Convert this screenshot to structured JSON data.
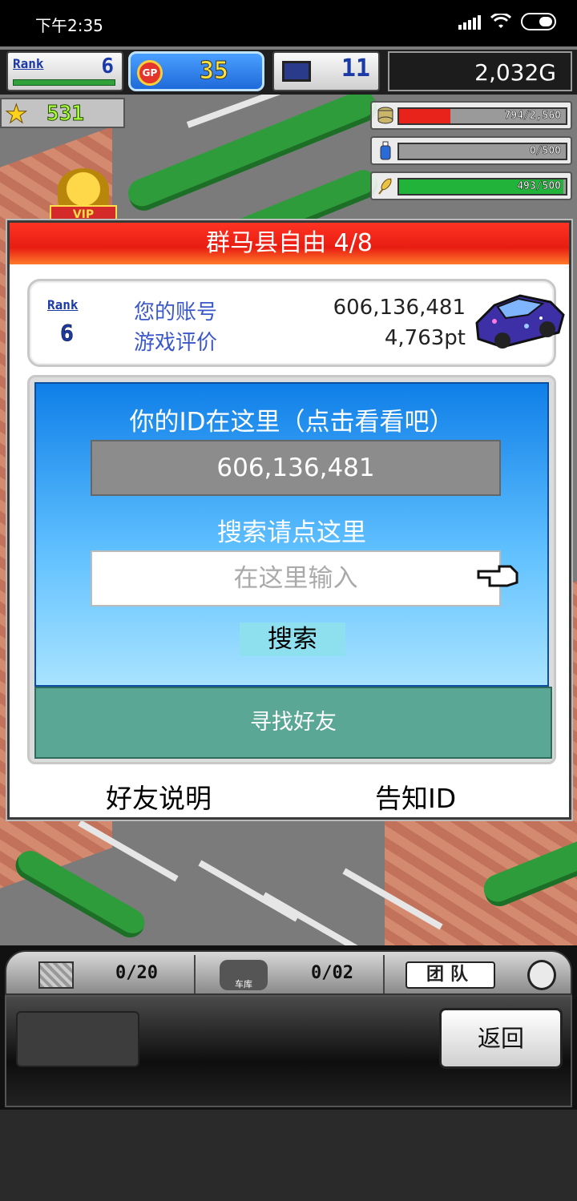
{
  "status_bar": {
    "time": "下午2:35"
  },
  "hud": {
    "rank_label": "Rank",
    "rank_value": "6",
    "gp_label": "GP",
    "gp_value": "35",
    "pc_value": "11",
    "gold": "2,032G",
    "stars": "531",
    "resources": [
      {
        "icon": "coin-stack-icon",
        "text": "794/2,560",
        "fill": 0.31,
        "color": "#e8231b"
      },
      {
        "icon": "bottle-icon",
        "text": "0/500",
        "fill": 0.0,
        "color": "#2a6bd8"
      },
      {
        "icon": "wheat-icon",
        "text": "493/500",
        "fill": 0.986,
        "color": "#22b33a"
      }
    ],
    "vip": "VIP"
  },
  "dialog": {
    "title": "群马县自由 4/8",
    "account": {
      "rank_label": "Rank",
      "rank_value": "6",
      "id_label": "您的账号",
      "id_value": "606,136,481",
      "rating_label": "游戏评价",
      "rating_value": "4,763pt"
    },
    "id_hint": "你的ID在这里（点击看看吧）",
    "id_value": "606,136,481",
    "search_hint": "搜索请点这里",
    "search_placeholder": "在这里输入",
    "search_button": "搜索",
    "find_friends": "寻找好友",
    "friend_help": "好友说明",
    "tell_id": "告知ID"
  },
  "bottom": {
    "tab1_count": "0/20",
    "tab2_label": "车库",
    "tab2_count": "0/02",
    "team_label": "团队",
    "back_button": "返回"
  },
  "colors": {
    "title_red": "#e81d12",
    "panel_blue": "#0f7fe8",
    "find_green": "#5aa795"
  }
}
